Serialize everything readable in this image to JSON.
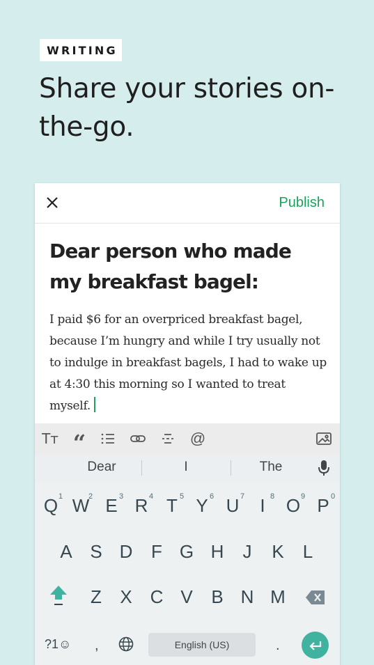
{
  "hero": {
    "badge": "WRITING",
    "headline": "Share your stories on-the-go."
  },
  "editor": {
    "publish_label": "Publish",
    "title": "Dear person who made my breakfast bagel:",
    "body": "I paid $6 for an overpriced breakfast bagel, because I’m hungry and while I try usually not to indulge in breakfast bagels, I had to wake up at 4:30 this morning so I wanted to treat myself."
  },
  "format_toolbar": {
    "icons": [
      "text-size-icon",
      "quote-icon",
      "list-icon",
      "link-icon",
      "separator-icon",
      "mention-icon",
      "image-icon"
    ],
    "text_size_label": "Tт",
    "quote_label": "“",
    "mention_label": "@"
  },
  "keyboard": {
    "suggestions": [
      "Dear",
      "I",
      "The"
    ],
    "row1": [
      "Q",
      "W",
      "E",
      "R",
      "T",
      "Y",
      "U",
      "I",
      "O",
      "P"
    ],
    "row1_numbers": [
      "1",
      "2",
      "3",
      "4",
      "5",
      "6",
      "7",
      "8",
      "9",
      "0"
    ],
    "row2": [
      "A",
      "S",
      "D",
      "F",
      "G",
      "H",
      "J",
      "K",
      "L"
    ],
    "row3": [
      "Z",
      "X",
      "C",
      "V",
      "B",
      "N",
      "M"
    ],
    "symbols_label": "?1☺",
    "comma_label": ",",
    "space_label": "English (US)",
    "period_label": ".",
    "accent_color": "#3fb3a0"
  },
  "colors": {
    "background": "#d6eded",
    "publish": "#1aa35a"
  }
}
